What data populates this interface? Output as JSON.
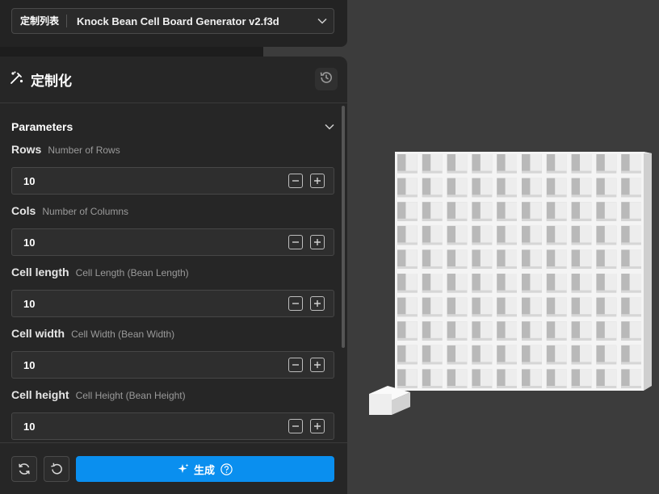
{
  "customize_list": {
    "prefix": "定制列表",
    "selected_file": "Knock Bean Cell Board Generator v2.f3d"
  },
  "panel": {
    "title": "定制化"
  },
  "parameters": {
    "section_label": "Parameters",
    "items": [
      {
        "name": "Rows",
        "desc": "Number of Rows",
        "value": "10"
      },
      {
        "name": "Cols",
        "desc": "Number of Columns",
        "value": "10"
      },
      {
        "name": "Cell length",
        "desc": "Cell Length (Bean Length)",
        "value": "10"
      },
      {
        "name": "Cell width",
        "desc": "Cell Width (Bean Width)",
        "value": "10"
      },
      {
        "name": "Cell height",
        "desc": "Cell Height (Bean Height)",
        "value": "10"
      }
    ]
  },
  "actions": {
    "generate_label": "生成"
  },
  "model": {
    "rows": 10,
    "cols": 10
  },
  "colors": {
    "accent": "#0a8fef",
    "panel_bg": "#262626",
    "viewport_bg": "#3c3c3c"
  }
}
